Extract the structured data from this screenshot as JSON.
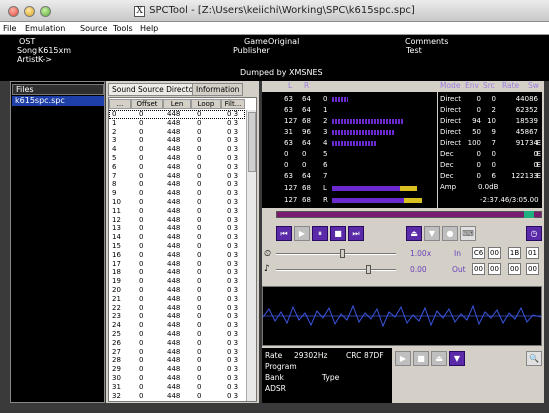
{
  "window": {
    "title": "SPCTool - [Z:\\Users\\keiichi\\Working\\SPC\\k615spc.spc]",
    "x_icon": "X"
  },
  "menu": [
    "File",
    "Emulation",
    "Source",
    "Tools",
    "Help"
  ],
  "info": {
    "ost": "OST",
    "song_label": "Song",
    "song": "K615xm",
    "artist_label": "Artist",
    "artist": "K->",
    "game_label": "Game",
    "game": "Original",
    "publisher_label": "Publisher",
    "comments_label": "Comments",
    "comments": "Test",
    "dumped": "Dumped by XMSNES"
  },
  "files": {
    "header": "Files",
    "selected": "k615spc.spc"
  },
  "tabs": {
    "ssd": "Sound Source Directory",
    "info": "Information"
  },
  "grid": {
    "headers": [
      "...",
      "Offset",
      "Len",
      "Loop",
      "Filt..."
    ],
    "rows": [
      [
        "0",
        "0",
        "448",
        "0",
        "0 3"
      ],
      [
        "1",
        "0",
        "448",
        "0",
        "0 3"
      ],
      [
        "2",
        "0",
        "448",
        "0",
        "0 3"
      ],
      [
        "3",
        "0",
        "448",
        "0",
        "0 3"
      ],
      [
        "4",
        "0",
        "448",
        "0",
        "0 3"
      ],
      [
        "5",
        "0",
        "448",
        "0",
        "0 3"
      ],
      [
        "6",
        "0",
        "448",
        "0",
        "0 3"
      ],
      [
        "7",
        "0",
        "448",
        "0",
        "0 3"
      ],
      [
        "8",
        "0",
        "448",
        "0",
        "0 3"
      ],
      [
        "9",
        "0",
        "448",
        "0",
        "0 3"
      ],
      [
        "10",
        "0",
        "448",
        "0",
        "0 3"
      ],
      [
        "11",
        "0",
        "448",
        "0",
        "0 3"
      ],
      [
        "12",
        "0",
        "448",
        "0",
        "0 3"
      ],
      [
        "13",
        "0",
        "448",
        "0",
        "0 3"
      ],
      [
        "14",
        "0",
        "448",
        "0",
        "0 3"
      ],
      [
        "15",
        "0",
        "448",
        "0",
        "0 3"
      ],
      [
        "16",
        "0",
        "448",
        "0",
        "0 3"
      ],
      [
        "17",
        "0",
        "448",
        "0",
        "0 3"
      ],
      [
        "18",
        "0",
        "448",
        "0",
        "0 3"
      ],
      [
        "19",
        "0",
        "448",
        "0",
        "0 3"
      ],
      [
        "20",
        "0",
        "448",
        "0",
        "0 3"
      ],
      [
        "21",
        "0",
        "448",
        "0",
        "0 3"
      ],
      [
        "22",
        "0",
        "448",
        "0",
        "0 3"
      ],
      [
        "23",
        "0",
        "448",
        "0",
        "0 3"
      ],
      [
        "24",
        "0",
        "448",
        "0",
        "0 3"
      ],
      [
        "25",
        "0",
        "448",
        "0",
        "0 3"
      ],
      [
        "26",
        "0",
        "448",
        "0",
        "0 3"
      ],
      [
        "27",
        "0",
        "448",
        "0",
        "0 3"
      ],
      [
        "28",
        "0",
        "448",
        "0",
        "0 3"
      ],
      [
        "29",
        "0",
        "448",
        "0",
        "0 3"
      ],
      [
        "30",
        "0",
        "448",
        "0",
        "0 3"
      ],
      [
        "31",
        "0",
        "448",
        "0",
        "0 3"
      ],
      [
        "32",
        "0",
        "448",
        "0",
        "0 3"
      ]
    ]
  },
  "meter": {
    "col_l": "L",
    "col_r": "R",
    "rows": [
      {
        "l": "63",
        "r": "64",
        "ch": "0",
        "level": 0.16
      },
      {
        "l": "63",
        "r": "64",
        "ch": "1",
        "level": 0
      },
      {
        "l": "127",
        "r": "68",
        "ch": "2",
        "level": 0.71
      },
      {
        "l": "31",
        "r": "96",
        "ch": "3",
        "level": 0.62
      },
      {
        "l": "63",
        "r": "64",
        "ch": "4",
        "level": 0.44
      },
      {
        "l": "0",
        "r": "0",
        "ch": "5",
        "level": 0
      },
      {
        "l": "0",
        "r": "0",
        "ch": "6",
        "level": 0
      },
      {
        "l": "63",
        "r": "64",
        "ch": "7",
        "level": 0
      }
    ],
    "master": [
      {
        "l": "127",
        "r": "68",
        "ch": "L",
        "level": 0.85
      },
      {
        "l": "127",
        "r": "68",
        "ch": "R",
        "level": 0.9
      }
    ]
  },
  "channels": {
    "headers": [
      "Mode",
      "Env",
      "Src",
      "Rate",
      "Sw"
    ],
    "rows": [
      [
        "Direct",
        "0",
        "0",
        "44086",
        ""
      ],
      [
        "Direct",
        "0",
        "2",
        "62352",
        ""
      ],
      [
        "Direct",
        "94",
        "10",
        "18539",
        ""
      ],
      [
        "Direct",
        "50",
        "9",
        "45867",
        ""
      ],
      [
        "Direct",
        "100",
        "7",
        "91734",
        "E"
      ],
      [
        "Dec",
        "0",
        "0",
        "0",
        "E"
      ],
      [
        "Dec",
        "0",
        "0",
        "0",
        "E"
      ],
      [
        "Dec",
        "0",
        "6",
        "122133",
        "E"
      ]
    ],
    "amp_label": "Amp",
    "amp": "0.0dB",
    "time": "-2:37.46/3:05.00"
  },
  "controls": {
    "speed": "1.00x",
    "pitch": "0.00",
    "in_label": "In",
    "out_label": "Out",
    "in_vals": [
      "C6",
      "00",
      "1B",
      "01"
    ],
    "out_vals": [
      "00",
      "00",
      "00",
      "00"
    ]
  },
  "sample": {
    "rate_label": "Rate",
    "rate": "29302Hz",
    "crc_label": "CRC",
    "crc": "87DF",
    "program_label": "Program",
    "bank_label": "Bank",
    "type_label": "Type",
    "adsr_label": "ADSR"
  },
  "colors": {
    "accent": "#5a2aa8",
    "meter": "#6a2ad0",
    "master": "#d8c020"
  }
}
